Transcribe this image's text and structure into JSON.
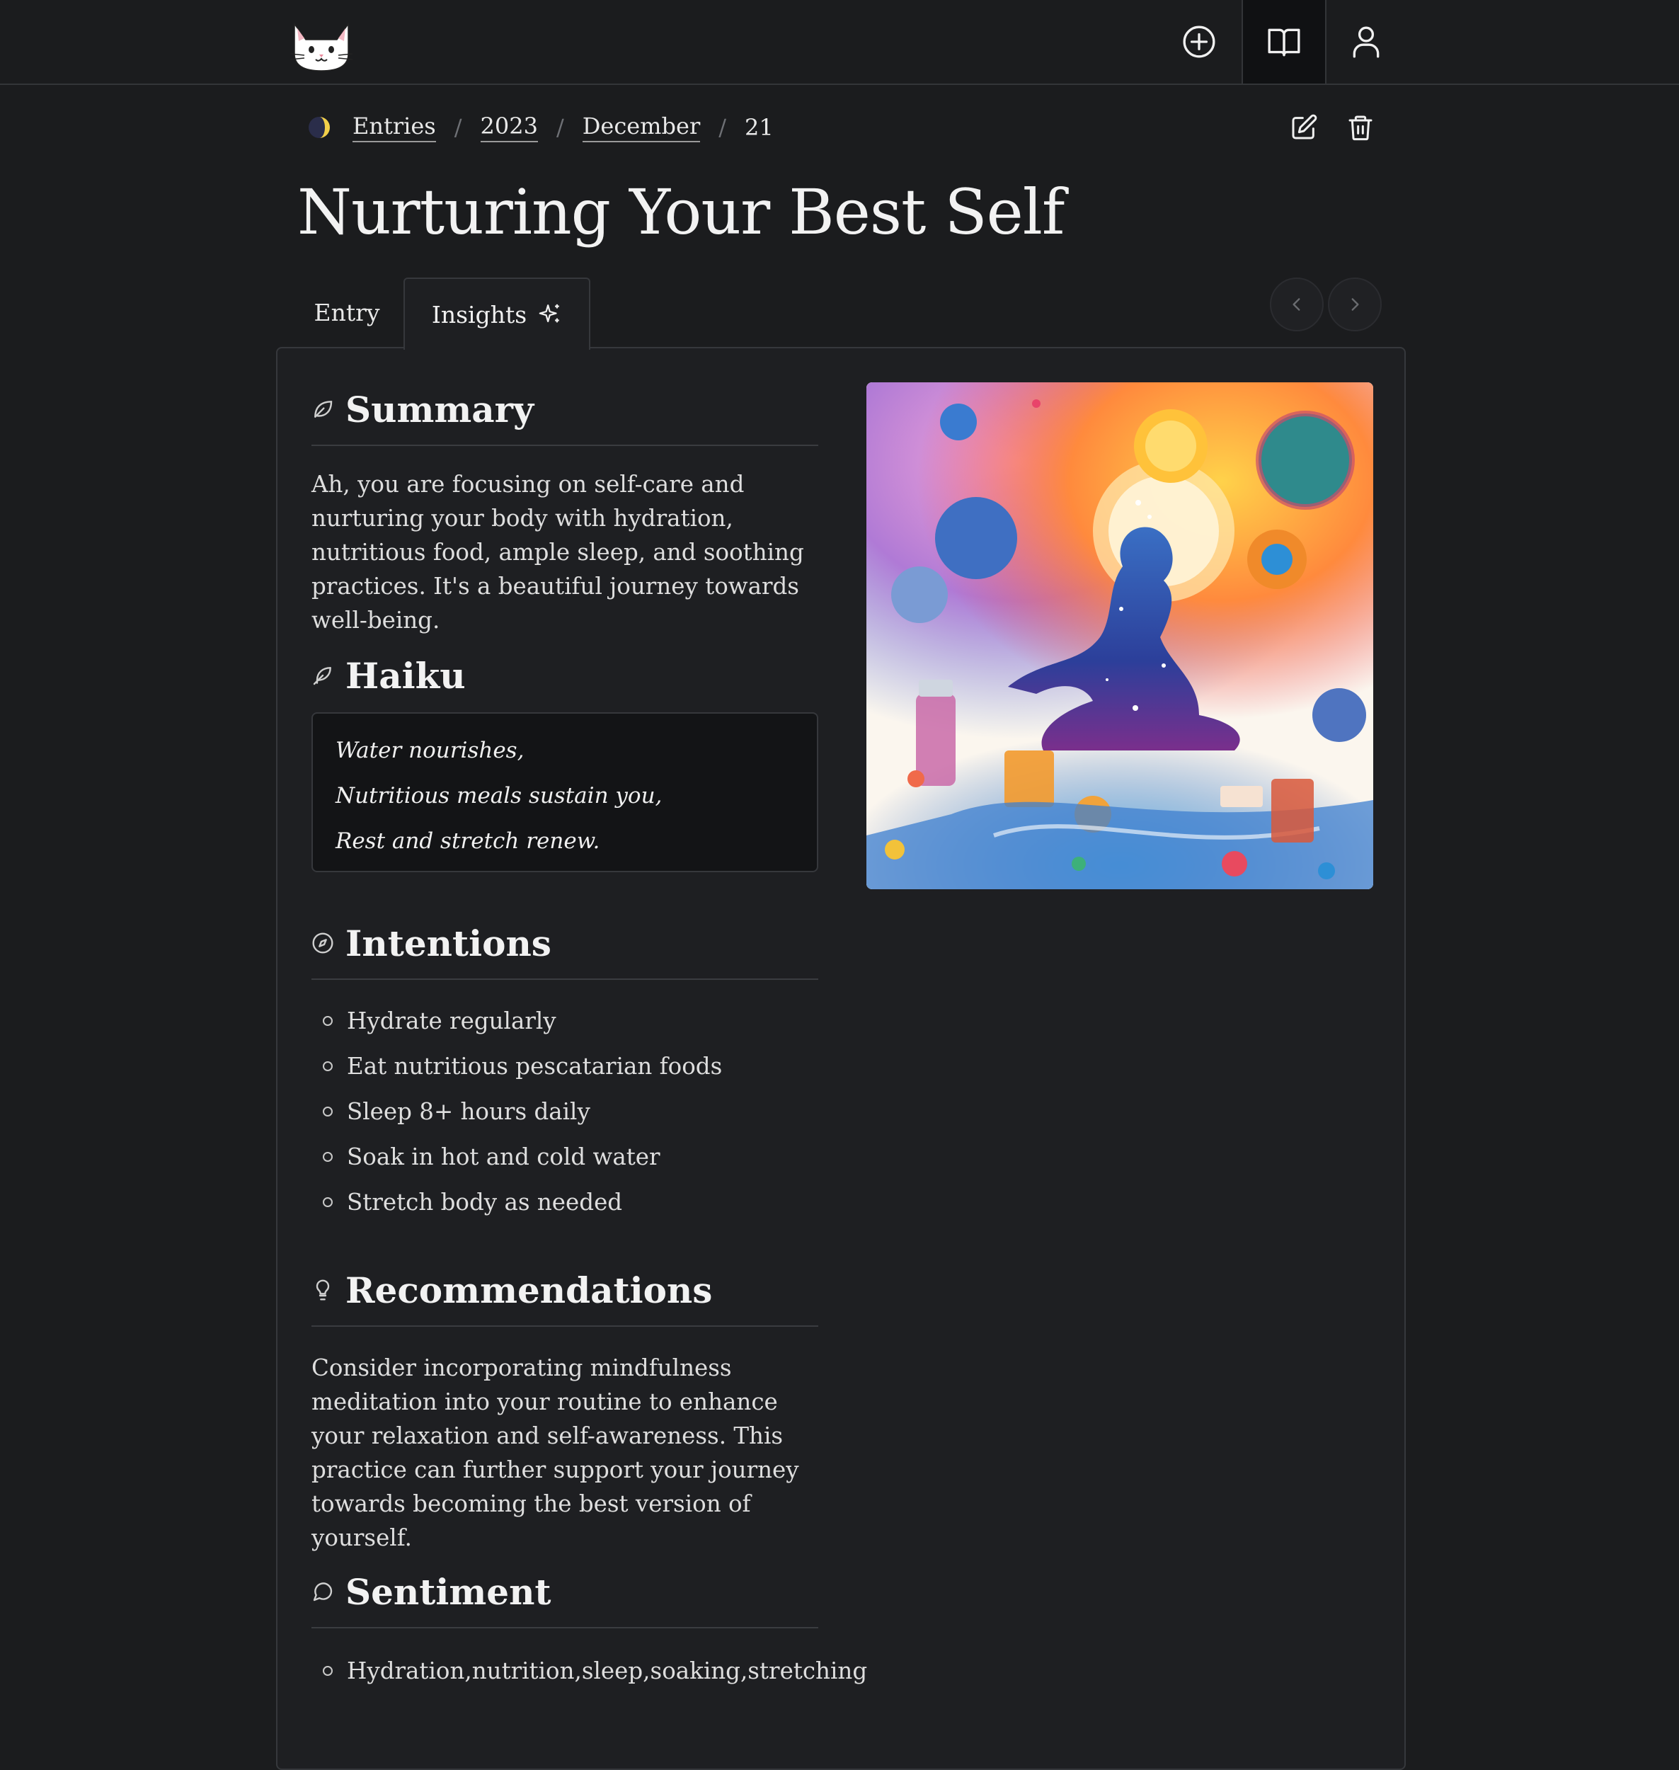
{
  "nav": {
    "logo_icon": "cat-icon",
    "items": [
      {
        "icon": "plus-circle-icon",
        "label": ""
      },
      {
        "icon": "book-open-icon",
        "label": ""
      },
      {
        "icon": "user-icon",
        "label": ""
      }
    ]
  },
  "breadcrumb": {
    "icon": "moon-phase-icon",
    "items": [
      "Entries",
      "2023",
      "December"
    ],
    "current": "21",
    "separator": "/"
  },
  "actions": {
    "edit_icon": "edit-icon",
    "delete_icon": "trash-icon"
  },
  "page": {
    "title": "Nurturing Your Best Self"
  },
  "tabs": [
    {
      "label": "Entry",
      "active": false
    },
    {
      "label": "Insights",
      "active": true,
      "icon": "sparkles-icon"
    }
  ],
  "pager": {
    "prev_icon": "chevron-left-icon",
    "next_icon": "chevron-right-icon"
  },
  "insights": {
    "summary": {
      "heading": "Summary",
      "icon": "leaf-icon",
      "text": "Ah, you are focusing on self-care and nurturing your body with hydration, nutritious food, ample sleep, and soothing practices. It's a beautiful journey towards well-being."
    },
    "haiku": {
      "heading": "Haiku",
      "icon": "feather-icon",
      "lines": [
        "Water nourishes,",
        "Nutritious meals sustain you,",
        "Rest and stretch renew."
      ]
    },
    "intentions": {
      "heading": "Intentions",
      "icon": "compass-icon",
      "items": [
        "Hydrate regularly",
        "Eat nutritious pescatarian foods",
        "Sleep 8+ hours daily",
        "Soak in hot and cold water",
        "Stretch body as needed"
      ]
    },
    "recommendations": {
      "heading": "Recommendations",
      "icon": "lightbulb-icon",
      "text": "Consider incorporating mindfulness meditation into your routine to enhance your relaxation and self-awareness. This practice can further support your journey towards becoming the best version of yourself."
    },
    "sentiment": {
      "heading": "Sentiment",
      "icon": "message-circle-icon",
      "items": [
        "Hydration,nutrition,sleep,soaking,stretching"
      ]
    }
  },
  "colors": {
    "background": "#1b1c1e",
    "card": "#1e1f22",
    "border": "#36383c",
    "text": "#e8e8e8"
  }
}
